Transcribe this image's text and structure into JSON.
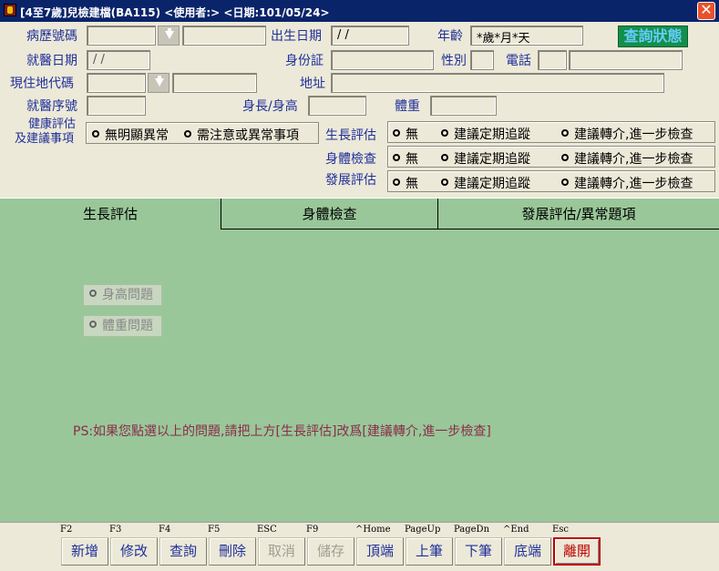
{
  "window": {
    "title": "[4至7歲]兒檢建檔(BA115)   <使用者:>   <日期:101/05/24>",
    "close_symbol": "✕"
  },
  "form": {
    "labels": {
      "chart_no": "病歷號碼",
      "birth_date": "出生日期",
      "age": "年齡",
      "visit_date": "就醫日期",
      "id_no": "身份証",
      "sex": "性別",
      "phone": "電話",
      "area_code": "現住地代碼",
      "address": "地址",
      "visit_seq": "就醫序號",
      "height_label": "身長/身高",
      "weight": "體重",
      "health_eval_line1": "健康評估",
      "health_eval_line2": "及建議事項",
      "growth_eval": "生長評估",
      "physical_exam": "身體檢查",
      "development_eval": "發展評估"
    },
    "values": {
      "birth_date": " / /",
      "age": "*歲*月*天",
      "visit_date": " / /"
    },
    "query_status": "查詢狀態",
    "health_options": [
      "無明顯異常",
      "需注意或異常事項"
    ],
    "eval_options": [
      "無",
      "建議定期追蹤",
      "建議轉介,進一步檢查"
    ]
  },
  "tabs": [
    "生長評估",
    "身體檢查",
    "發展評估/異常題項"
  ],
  "growth_tab": {
    "checkboxes": [
      "身高問題",
      "體重問題"
    ],
    "note": "PS:如果您點選以上的問題,請把上方[生長評估]改爲[建議轉介,進一步檢查]"
  },
  "toolbar": {
    "buttons": [
      {
        "key": "F2",
        "label": "新增"
      },
      {
        "key": "F3",
        "label": "修改"
      },
      {
        "key": "F4",
        "label": "查詢"
      },
      {
        "key": "F5",
        "label": "刪除"
      },
      {
        "key": "ESC",
        "label": "取消"
      },
      {
        "key": "F9",
        "label": "儲存"
      },
      {
        "key": "^Home",
        "label": "頂端"
      },
      {
        "key": "PageUp",
        "label": "上筆"
      },
      {
        "key": "PageDn",
        "label": "下筆"
      },
      {
        "key": "^End",
        "label": "底端"
      },
      {
        "key": "Esc",
        "label": "離開"
      }
    ]
  }
}
